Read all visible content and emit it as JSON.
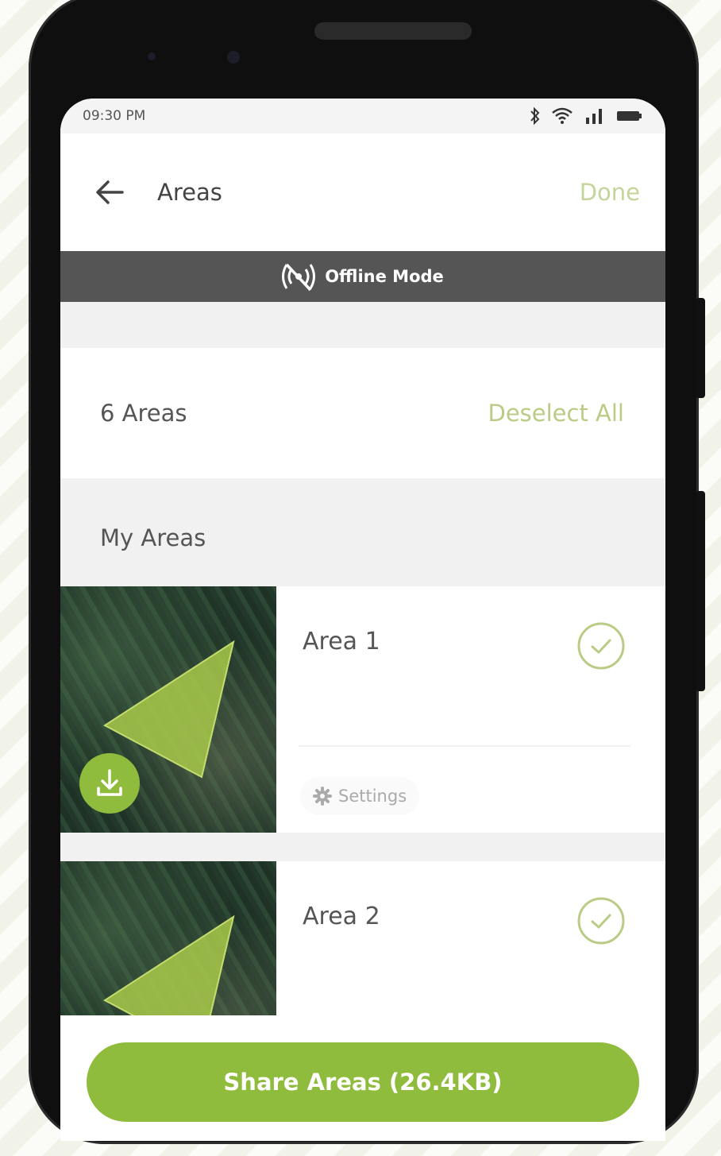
{
  "status": {
    "time": "09:30 PM",
    "icons": [
      "bluetooth-icon",
      "wifi-icon",
      "signal-icon",
      "battery-icon"
    ]
  },
  "header": {
    "title": "Areas",
    "done_label": "Done",
    "back_icon": "arrow-left-icon"
  },
  "offline": {
    "label": "Offline Mode",
    "icon": "signal-off-icon"
  },
  "summary": {
    "count_label": "6 Areas",
    "deselect_label": "Deselect All"
  },
  "section": {
    "title": "My Areas"
  },
  "areas": [
    {
      "name": "Area 1",
      "selected": true,
      "settings_label": "Settings",
      "downloaded": true
    },
    {
      "name": "Area 2",
      "selected": true
    }
  ],
  "footer": {
    "share_label": "Share Areas (26.4KB)"
  },
  "colors": {
    "accent": "#8fbc3c",
    "accent_light": "#c4d59a",
    "offline_bar": "#555555"
  }
}
